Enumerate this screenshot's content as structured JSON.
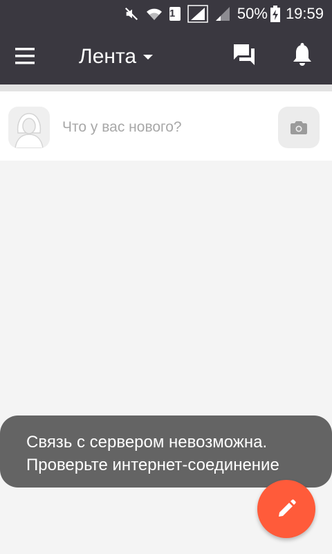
{
  "status_bar": {
    "sim_label": "1",
    "battery_percent": "50%",
    "time": "19:59",
    "icons": [
      "mute-icon",
      "wifi-icon",
      "signal-icon",
      "signal-weak-icon",
      "battery-charging-icon"
    ]
  },
  "app_bar": {
    "title": "Лента",
    "icons": [
      "menu-icon",
      "chevron-down-icon",
      "chat-icon",
      "bell-icon"
    ]
  },
  "composer": {
    "placeholder": "Что у вас нового?",
    "value": ""
  },
  "toast": {
    "line1": "Связь с сервером невозможна.",
    "line2": "Проверьте интернет-соединение"
  },
  "fab": {
    "icon": "pencil-icon"
  },
  "colors": {
    "bar": "#3a3840",
    "background": "#f4f4f4",
    "fab": "#ff5b3a",
    "toast": "#646464"
  }
}
